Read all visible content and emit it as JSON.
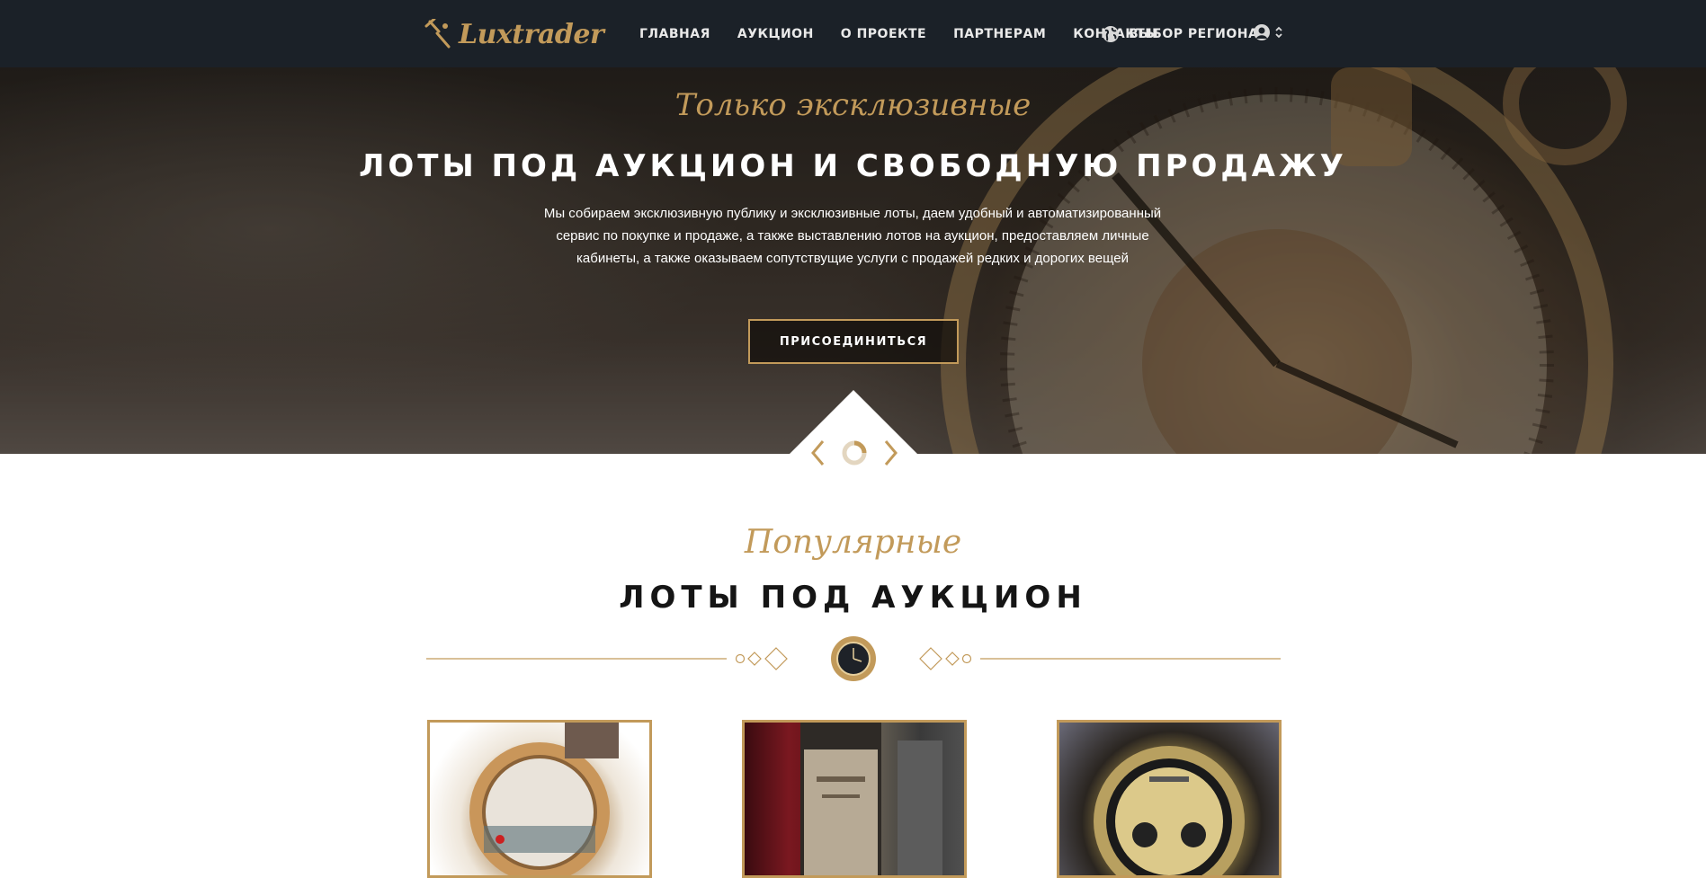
{
  "nav": {
    "logo_text": "Luxtrader",
    "menu": [
      "ГЛАВНАЯ",
      "АУКЦИОН",
      "О ПРОЕКТЕ",
      "ПАРТНЕРАМ",
      "КОНТАКТЫ"
    ],
    "region_label": "ВЫБОР РЕГИОНА"
  },
  "hero": {
    "script": "Только эксклюзивные",
    "title": "ЛОТЫ ПОД АУКЦИОН И СВОБОДНУЮ ПРОДАЖУ",
    "description": "Мы собираем эксклюзивную публику и эксклюзивные лоты, даем удобный и автоматизированный сервис по покупке и продаже, а также выставлению лотов на аукцион, предоставляем личные кабинеты, а также оказываем сопутствущие услуги с продажей редких и дорогих вещей",
    "button": "ПРИСОЕДИНИТЬСЯ"
  },
  "popular": {
    "script": "Популярные",
    "title": "ЛОТЫ ПОД АУКЦИОН"
  },
  "colors": {
    "accent": "#c29a5a",
    "nav_bg": "#1b2128"
  },
  "icons": [
    "gavel-icon",
    "globe-icon",
    "user-icon",
    "chevron-updown-icon",
    "chevron-left-icon",
    "spinner-icon",
    "chevron-right-icon",
    "watch-icon"
  ]
}
